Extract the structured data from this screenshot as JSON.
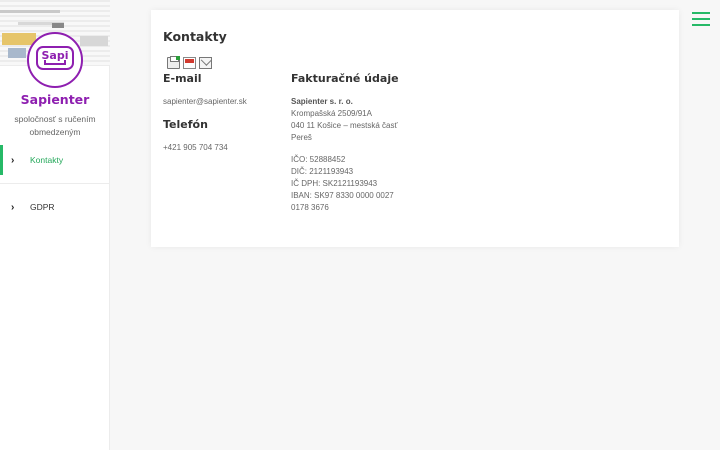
{
  "sidebar": {
    "brand": "Sapienter",
    "logo_text": "Sapi",
    "tagline": "spoločnosť s ručením obmedzeným",
    "items": [
      {
        "label": "Kontakty",
        "active": true
      },
      {
        "label": "GDPR",
        "active": false
      }
    ]
  },
  "main": {
    "title": "Kontakty",
    "toolbar_icons": [
      "print-icon",
      "pdf-icon",
      "email-icon"
    ],
    "email": {
      "heading": "E-mail",
      "value": "sapienter@sapienter.sk"
    },
    "phone": {
      "heading": "Telefón",
      "value": "+421 905 704 734"
    },
    "billing": {
      "heading": "Fakturačné údaje",
      "company": "Sapienter s. r. o.",
      "street": "Krompašská 2509/91A",
      "city": "040 11 Košice – mestská časť",
      "district": "Pereš",
      "ico": "IČO: 52888452",
      "dic": "DIČ: 2121193943",
      "icdph": "IČ DPH: SK2121193943",
      "iban_line1": "IBAN: SK97 8330 0000 0027",
      "iban_line2": "0178 3676"
    }
  },
  "colors": {
    "accent": "#26b967",
    "brand": "#8e1fb0"
  }
}
